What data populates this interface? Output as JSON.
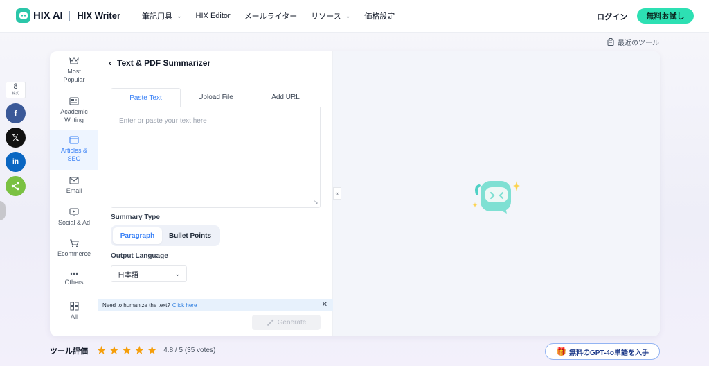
{
  "header": {
    "brand": "HIX AI",
    "product": "HIX Writer",
    "nav": [
      {
        "label": "筆記用具",
        "dropdown": true
      },
      {
        "label": "HIX Editor",
        "dropdown": false
      },
      {
        "label": "メールライター",
        "dropdown": false
      },
      {
        "label": "リソース",
        "dropdown": true
      },
      {
        "label": "価格設定",
        "dropdown": false
      }
    ],
    "login": "ログイン",
    "trial": "無料お試し"
  },
  "recent_tools": "最近のツール",
  "share": {
    "count": "8",
    "count_label": "株式",
    "networks": [
      {
        "name": "facebook",
        "glyph": "f",
        "color": "#3b5998"
      },
      {
        "name": "x",
        "glyph": "𝕏",
        "color": "#111111"
      },
      {
        "name": "linkedin",
        "glyph": "in",
        "color": "#0a66c2"
      },
      {
        "name": "share",
        "glyph": "share",
        "color": "#7ac142"
      }
    ]
  },
  "sidebar": {
    "items": [
      {
        "label": "Most\nPopular",
        "icon": "crown-icon",
        "active": false
      },
      {
        "label": "Academic\nWriting",
        "icon": "newspaper-icon",
        "active": false
      },
      {
        "label": "Articles &\nSEO",
        "icon": "article-icon",
        "active": true
      },
      {
        "label": "Email",
        "icon": "mail-icon",
        "active": false
      },
      {
        "label": "Social & Ad",
        "icon": "monitor-icon",
        "active": false
      },
      {
        "label": "Ecommerce",
        "icon": "cart-icon",
        "active": false
      },
      {
        "label": "Others",
        "icon": "more-icon",
        "active": false
      },
      {
        "label": "All",
        "icon": "grid-icon",
        "active": false
      }
    ]
  },
  "tool": {
    "title": "Text & PDF Summarizer",
    "tabs": [
      {
        "label": "Paste Text",
        "active": true
      },
      {
        "label": "Upload File",
        "active": false
      },
      {
        "label": "Add URL",
        "active": false
      }
    ],
    "input_placeholder": "Enter or paste your text here",
    "summary_type_label": "Summary Type",
    "summary_types": [
      {
        "label": "Paragraph",
        "active": true
      },
      {
        "label": "Bullet Points",
        "active": false
      }
    ],
    "output_language_label": "Output Language",
    "output_language": "日本語",
    "banner_text": "Need to humanize the text?",
    "banner_link": "Click here",
    "generate": "Generate"
  },
  "rating": {
    "title": "ツール評価",
    "stars": 4.8,
    "text": "4.8 / 5 (35 votes)"
  },
  "gpt_button": "無料のGPT-4o単語を入手",
  "colors": {
    "accent": "#3b82f6",
    "brand": "#2bc6a9",
    "trial": "#2de0b3",
    "star": "#f59e0b"
  }
}
